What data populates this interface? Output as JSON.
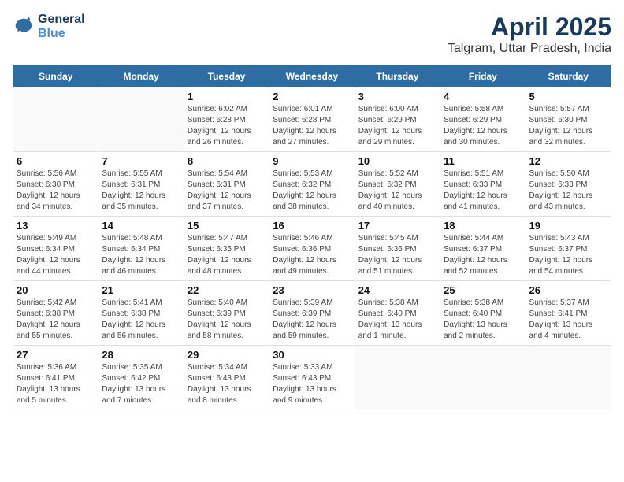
{
  "header": {
    "logo_line1": "General",
    "logo_line2": "Blue",
    "title": "April 2025",
    "subtitle": "Talgram, Uttar Pradesh, India"
  },
  "calendar": {
    "weekdays": [
      "Sunday",
      "Monday",
      "Tuesday",
      "Wednesday",
      "Thursday",
      "Friday",
      "Saturday"
    ],
    "weeks": [
      [
        {
          "day": null
        },
        {
          "day": null
        },
        {
          "day": "1",
          "sunrise": "Sunrise: 6:02 AM",
          "sunset": "Sunset: 6:28 PM",
          "daylight": "Daylight: 12 hours and 26 minutes."
        },
        {
          "day": "2",
          "sunrise": "Sunrise: 6:01 AM",
          "sunset": "Sunset: 6:28 PM",
          "daylight": "Daylight: 12 hours and 27 minutes."
        },
        {
          "day": "3",
          "sunrise": "Sunrise: 6:00 AM",
          "sunset": "Sunset: 6:29 PM",
          "daylight": "Daylight: 12 hours and 29 minutes."
        },
        {
          "day": "4",
          "sunrise": "Sunrise: 5:58 AM",
          "sunset": "Sunset: 6:29 PM",
          "daylight": "Daylight: 12 hours and 30 minutes."
        },
        {
          "day": "5",
          "sunrise": "Sunrise: 5:57 AM",
          "sunset": "Sunset: 6:30 PM",
          "daylight": "Daylight: 12 hours and 32 minutes."
        }
      ],
      [
        {
          "day": "6",
          "sunrise": "Sunrise: 5:56 AM",
          "sunset": "Sunset: 6:30 PM",
          "daylight": "Daylight: 12 hours and 34 minutes."
        },
        {
          "day": "7",
          "sunrise": "Sunrise: 5:55 AM",
          "sunset": "Sunset: 6:31 PM",
          "daylight": "Daylight: 12 hours and 35 minutes."
        },
        {
          "day": "8",
          "sunrise": "Sunrise: 5:54 AM",
          "sunset": "Sunset: 6:31 PM",
          "daylight": "Daylight: 12 hours and 37 minutes."
        },
        {
          "day": "9",
          "sunrise": "Sunrise: 5:53 AM",
          "sunset": "Sunset: 6:32 PM",
          "daylight": "Daylight: 12 hours and 38 minutes."
        },
        {
          "day": "10",
          "sunrise": "Sunrise: 5:52 AM",
          "sunset": "Sunset: 6:32 PM",
          "daylight": "Daylight: 12 hours and 40 minutes."
        },
        {
          "day": "11",
          "sunrise": "Sunrise: 5:51 AM",
          "sunset": "Sunset: 6:33 PM",
          "daylight": "Daylight: 12 hours and 41 minutes."
        },
        {
          "day": "12",
          "sunrise": "Sunrise: 5:50 AM",
          "sunset": "Sunset: 6:33 PM",
          "daylight": "Daylight: 12 hours and 43 minutes."
        }
      ],
      [
        {
          "day": "13",
          "sunrise": "Sunrise: 5:49 AM",
          "sunset": "Sunset: 6:34 PM",
          "daylight": "Daylight: 12 hours and 44 minutes."
        },
        {
          "day": "14",
          "sunrise": "Sunrise: 5:48 AM",
          "sunset": "Sunset: 6:34 PM",
          "daylight": "Daylight: 12 hours and 46 minutes."
        },
        {
          "day": "15",
          "sunrise": "Sunrise: 5:47 AM",
          "sunset": "Sunset: 6:35 PM",
          "daylight": "Daylight: 12 hours and 48 minutes."
        },
        {
          "day": "16",
          "sunrise": "Sunrise: 5:46 AM",
          "sunset": "Sunset: 6:36 PM",
          "daylight": "Daylight: 12 hours and 49 minutes."
        },
        {
          "day": "17",
          "sunrise": "Sunrise: 5:45 AM",
          "sunset": "Sunset: 6:36 PM",
          "daylight": "Daylight: 12 hours and 51 minutes."
        },
        {
          "day": "18",
          "sunrise": "Sunrise: 5:44 AM",
          "sunset": "Sunset: 6:37 PM",
          "daylight": "Daylight: 12 hours and 52 minutes."
        },
        {
          "day": "19",
          "sunrise": "Sunrise: 5:43 AM",
          "sunset": "Sunset: 6:37 PM",
          "daylight": "Daylight: 12 hours and 54 minutes."
        }
      ],
      [
        {
          "day": "20",
          "sunrise": "Sunrise: 5:42 AM",
          "sunset": "Sunset: 6:38 PM",
          "daylight": "Daylight: 12 hours and 55 minutes."
        },
        {
          "day": "21",
          "sunrise": "Sunrise: 5:41 AM",
          "sunset": "Sunset: 6:38 PM",
          "daylight": "Daylight: 12 hours and 56 minutes."
        },
        {
          "day": "22",
          "sunrise": "Sunrise: 5:40 AM",
          "sunset": "Sunset: 6:39 PM",
          "daylight": "Daylight: 12 hours and 58 minutes."
        },
        {
          "day": "23",
          "sunrise": "Sunrise: 5:39 AM",
          "sunset": "Sunset: 6:39 PM",
          "daylight": "Daylight: 12 hours and 59 minutes."
        },
        {
          "day": "24",
          "sunrise": "Sunrise: 5:38 AM",
          "sunset": "Sunset: 6:40 PM",
          "daylight": "Daylight: 13 hours and 1 minute."
        },
        {
          "day": "25",
          "sunrise": "Sunrise: 5:38 AM",
          "sunset": "Sunset: 6:40 PM",
          "daylight": "Daylight: 13 hours and 2 minutes."
        },
        {
          "day": "26",
          "sunrise": "Sunrise: 5:37 AM",
          "sunset": "Sunset: 6:41 PM",
          "daylight": "Daylight: 13 hours and 4 minutes."
        }
      ],
      [
        {
          "day": "27",
          "sunrise": "Sunrise: 5:36 AM",
          "sunset": "Sunset: 6:41 PM",
          "daylight": "Daylight: 13 hours and 5 minutes."
        },
        {
          "day": "28",
          "sunrise": "Sunrise: 5:35 AM",
          "sunset": "Sunset: 6:42 PM",
          "daylight": "Daylight: 13 hours and 7 minutes."
        },
        {
          "day": "29",
          "sunrise": "Sunrise: 5:34 AM",
          "sunset": "Sunset: 6:43 PM",
          "daylight": "Daylight: 13 hours and 8 minutes."
        },
        {
          "day": "30",
          "sunrise": "Sunrise: 5:33 AM",
          "sunset": "Sunset: 6:43 PM",
          "daylight": "Daylight: 13 hours and 9 minutes."
        },
        {
          "day": null
        },
        {
          "day": null
        },
        {
          "day": null
        }
      ]
    ]
  }
}
